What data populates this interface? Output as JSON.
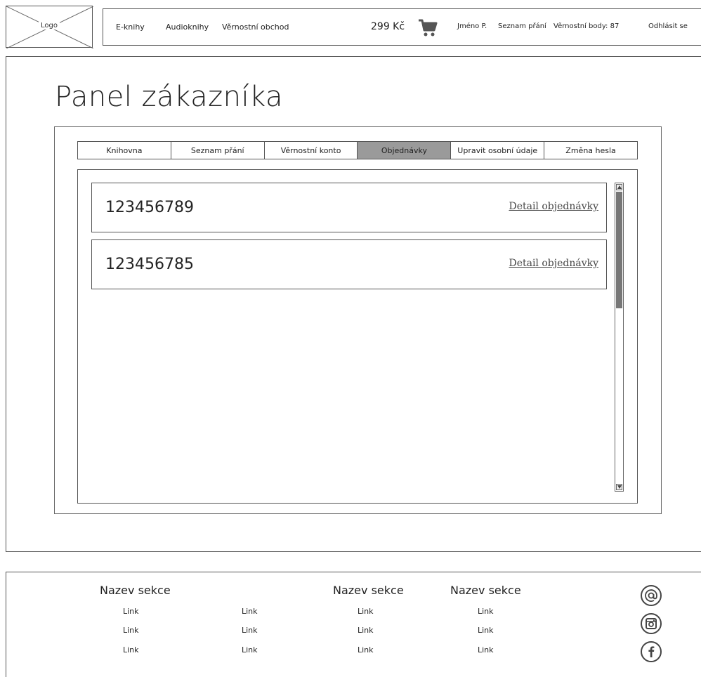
{
  "header": {
    "logo": "Logo",
    "nav": [
      "E-knihy",
      "Audioknihy",
      "Věrnostní obchod"
    ],
    "cart_price": "299 Kč",
    "user": {
      "name": "Jméno P.",
      "wishlist": "Seznam přání",
      "points": "Věrnostní body: 87",
      "logout": "Odhlásit se"
    }
  },
  "main": {
    "title": "Panel zákazníka",
    "tabs": [
      "Knihovna",
      "Seznam přání",
      "Věrnostní konto",
      "Objednávky",
      "Upravit osobní údaje",
      "Změna hesla"
    ],
    "active_tab": "Objednávky",
    "orders": [
      {
        "number": "123456789",
        "link": "Detail objednávky"
      },
      {
        "number": "123456785",
        "link": "Detail objednávky"
      }
    ]
  },
  "footer": {
    "sections": [
      "Nazev sekce",
      "Nazev sekce",
      "Nazev sekce"
    ],
    "links": [
      "Link",
      "Link",
      "Link"
    ],
    "social_icons": [
      "at-icon",
      "instagram-icon",
      "facebook-icon"
    ]
  },
  "colors": {
    "active_tab": "#9a9a9a",
    "scroll_thumb": "#777777",
    "border": "#555555"
  }
}
